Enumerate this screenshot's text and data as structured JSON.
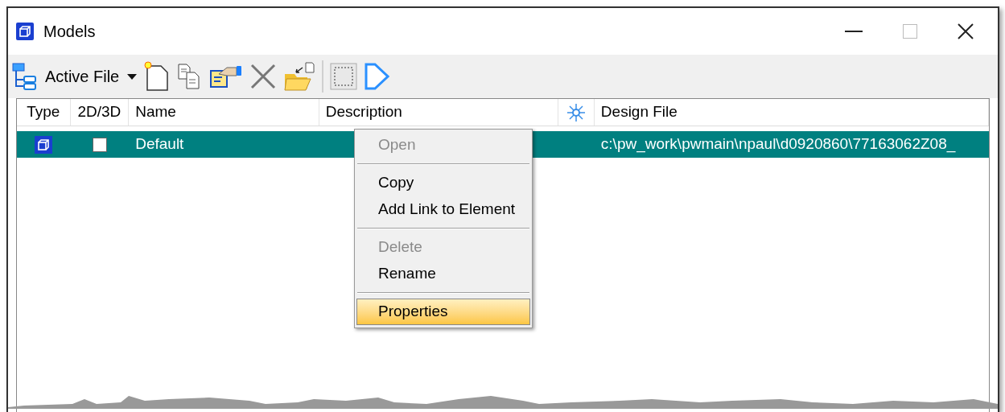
{
  "window": {
    "title": "Models"
  },
  "toolbar": {
    "source_dropdown": "Active File"
  },
  "table": {
    "columns": [
      {
        "label": "Type"
      },
      {
        "label": "2D/3D"
      },
      {
        "label": "Name"
      },
      {
        "label": "Description"
      },
      {
        "kind": "icon"
      },
      {
        "label": "Design File"
      }
    ],
    "rows": [
      {
        "selected": true,
        "checked": false,
        "name": "Default",
        "design_file": "c:\\pw_work\\pwmain\\npaul\\d0920860\\77163062Z08_"
      }
    ]
  },
  "context_menu": [
    {
      "kind": "item",
      "label": "Open",
      "disabled": true,
      "highlighted": false
    },
    {
      "kind": "separator"
    },
    {
      "kind": "item",
      "label": "Copy",
      "disabled": false,
      "highlighted": false
    },
    {
      "kind": "item",
      "label": "Add Link to Element",
      "disabled": false,
      "highlighted": false
    },
    {
      "kind": "separator"
    },
    {
      "kind": "item",
      "label": "Delete",
      "disabled": true,
      "highlighted": false
    },
    {
      "kind": "item",
      "label": "Rename",
      "disabled": false,
      "highlighted": false
    },
    {
      "kind": "separator"
    },
    {
      "kind": "item",
      "label": "Properties",
      "disabled": false,
      "highlighted": true
    }
  ]
}
